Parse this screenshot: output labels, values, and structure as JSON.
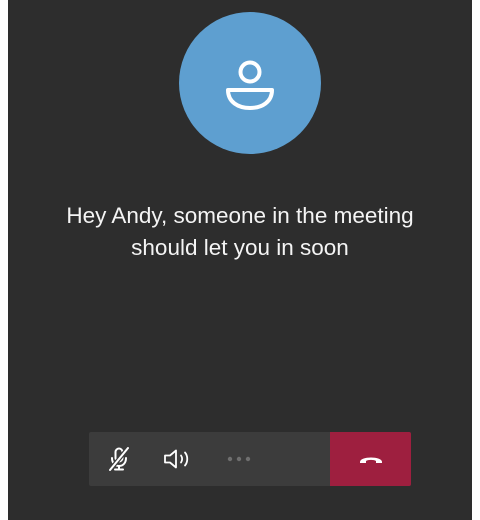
{
  "call": {
    "message_line1": "Hey Andy, someone in the meeting",
    "message_line2": "should let you in soon"
  },
  "controls": [
    {
      "icon": "microphone-muted-icon",
      "action": "unmute"
    },
    {
      "icon": "speaker-icon",
      "action": "audio-output"
    },
    {
      "icon": "more-options-icon",
      "action": "more",
      "state": "disabled"
    },
    {
      "icon": "hang-up-icon",
      "action": "leave"
    }
  ],
  "colors": {
    "background": "#2d2d2d",
    "avatar": "#5e9fd0",
    "control_bar": "#3c3c3c",
    "hang_up": "#9e1f3f",
    "text": "#f4f4f4"
  }
}
